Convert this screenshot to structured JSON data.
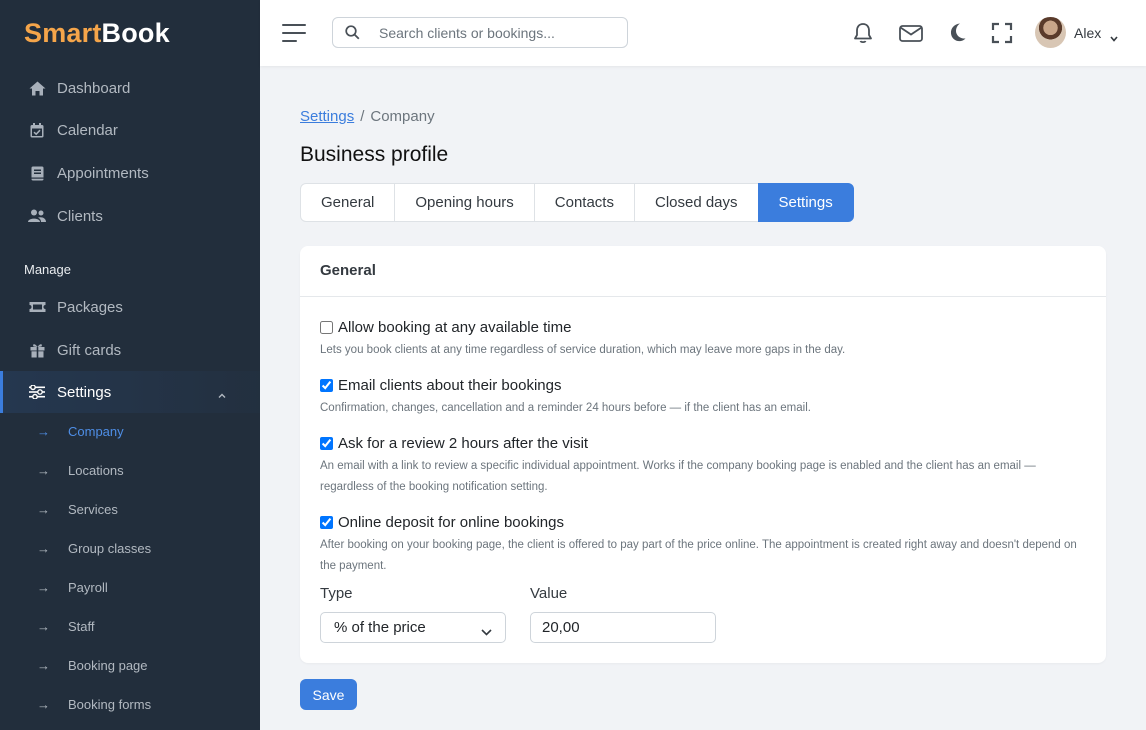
{
  "brand": {
    "part1": "Smart",
    "part2": "Book"
  },
  "sidebar": {
    "items": [
      {
        "label": "Dashboard",
        "icon": "home-icon"
      },
      {
        "label": "Calendar",
        "icon": "calendar-icon"
      },
      {
        "label": "Appointments",
        "icon": "book-icon"
      },
      {
        "label": "Clients",
        "icon": "users-icon"
      }
    ],
    "section_label": "Manage",
    "manage_items": [
      {
        "label": "Packages",
        "icon": "ticket-icon"
      },
      {
        "label": "Gift cards",
        "icon": "gift-icon"
      },
      {
        "label": "Settings",
        "icon": "sliders-icon",
        "active": true
      }
    ],
    "settings_sub": [
      {
        "label": "Company",
        "active": true
      },
      {
        "label": "Locations"
      },
      {
        "label": "Services"
      },
      {
        "label": "Group classes"
      },
      {
        "label": "Payroll"
      },
      {
        "label": "Staff"
      },
      {
        "label": "Booking page"
      },
      {
        "label": "Booking forms"
      }
    ]
  },
  "topbar": {
    "search_placeholder": "Search clients or bookings...",
    "user_name": "Alex"
  },
  "breadcrumb": {
    "parent": "Settings",
    "separator": "/",
    "current": "Company"
  },
  "page_title": "Business profile",
  "tabs": [
    {
      "label": "General"
    },
    {
      "label": "Opening hours"
    },
    {
      "label": "Contacts"
    },
    {
      "label": "Closed days"
    },
    {
      "label": "Settings",
      "active": true
    }
  ],
  "card": {
    "title": "General",
    "options": [
      {
        "label": "Allow booking at any available time",
        "checked": false,
        "desc": "Lets you book clients at any time regardless of service duration, which may leave more gaps in the day."
      },
      {
        "label": "Email clients about their bookings",
        "checked": true,
        "desc": "Confirmation, changes, cancellation and a reminder 24 hours before — if the client has an email."
      },
      {
        "label": "Ask for a review 2 hours after the visit",
        "checked": true,
        "desc": "An email with a link to review a specific individual appointment. Works if the company booking page is enabled and the client has an email — regardless of the booking notification setting."
      },
      {
        "label": "Online deposit for online bookings",
        "checked": true,
        "desc": "After booking on your booking page, the client is offered to pay part of the price online. The appointment is created right away and doesn't depend on the payment."
      }
    ],
    "type_label": "Type",
    "type_value": "% of the price",
    "value_label": "Value",
    "value_value": "20,00"
  },
  "save_label": "Save",
  "colors": {
    "accent": "#3b7ddd",
    "sidebar_bg": "#222e3c",
    "brand_orange": "#f5a54a"
  }
}
